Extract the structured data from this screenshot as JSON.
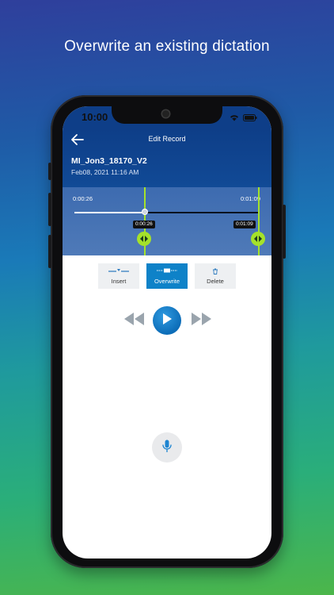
{
  "headline": "Overwrite an existing dictation",
  "status_bar": {
    "time": "10:00"
  },
  "app_bar": {
    "title": "Edit Record",
    "record_name": "MI_Jon3_18170_V2",
    "record_date": "Feb08, 2021 11:16 AM"
  },
  "timeline": {
    "start_time": "0:00:26",
    "end_time": "0:01:09",
    "playhead_progress": 0.38,
    "marker_left_label": "0:00:26",
    "marker_right_label": "0:01:09"
  },
  "edit_modes": [
    {
      "label": "Insert",
      "active": false
    },
    {
      "label": "Overwrite",
      "active": true
    },
    {
      "label": "Delete",
      "active": false
    }
  ],
  "icons": {
    "back": "arrow-left-icon",
    "rewind": "rewind-icon",
    "play": "play-icon",
    "fast_forward": "fast-forward-icon",
    "microphone": "microphone-icon",
    "insert": "insert-icon",
    "overwrite": "overwrite-icon",
    "delete": "trash-icon"
  },
  "colors": {
    "accent": "#0e82c8",
    "app_bar": "#0e3e88",
    "marker": "#a5e22a"
  }
}
